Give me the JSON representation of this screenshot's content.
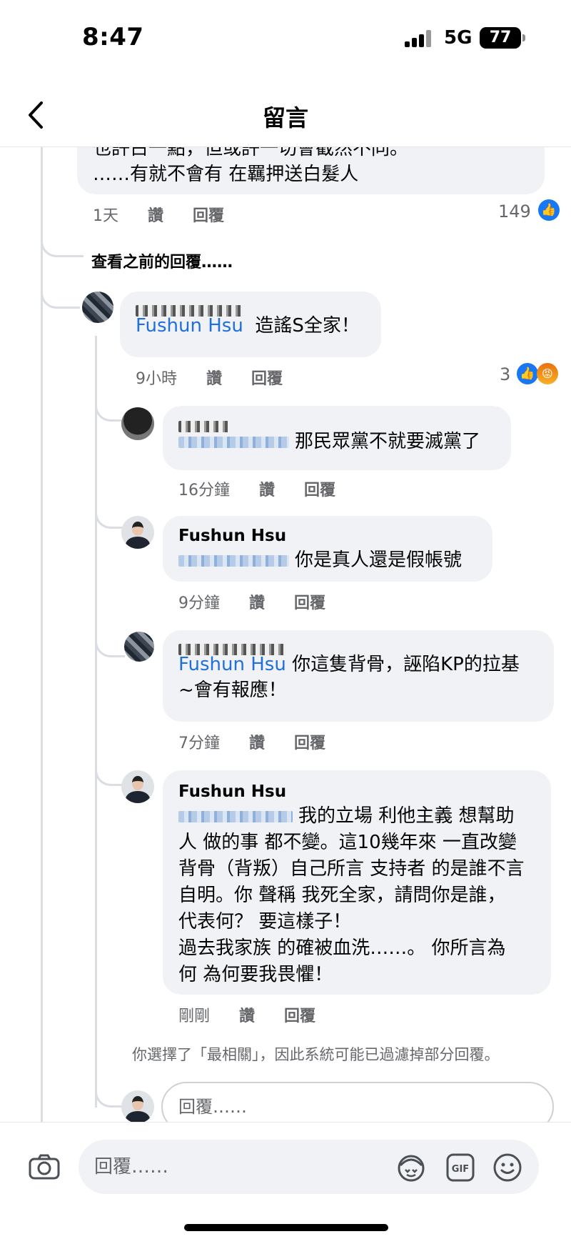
{
  "status": {
    "time": "8:47",
    "network": "5G",
    "battery": "77"
  },
  "header": {
    "title": "留言"
  },
  "top_comment": {
    "line1": "也許占一點，但或許一切會截然不同。",
    "line2": "……有就不會有 在羈押送白髮人",
    "time": "1天",
    "like": "讚",
    "reply": "回覆",
    "reactions": "149"
  },
  "view_previous": "查看之前的回覆……",
  "comments": [
    {
      "mention": "Fushun Hsu",
      "text": "造謠S全家！",
      "time": "9小時",
      "like": "讚",
      "reply": "回覆",
      "reactions": "3"
    },
    {
      "text": "那民眾黨不就要滅黨了",
      "time": "16分鐘",
      "like": "讚",
      "reply": "回覆"
    },
    {
      "name": "Fushun Hsu",
      "text": "你是真人還是假帳號",
      "time": "9分鐘",
      "like": "讚",
      "reply": "回覆"
    },
    {
      "mention": "Fushun Hsu",
      "text1": "你這隻背骨，誣陷KP的拉基",
      "text2": "~會有報應！",
      "time": "7分鐘",
      "like": "讚",
      "reply": "回覆"
    },
    {
      "name": "Fushun Hsu",
      "lines": [
        "我的立場 利他主義 想幫助",
        "人 做的事 都不變。這10幾年來 一直改變",
        "背骨（背叛）自己所言 支持者 的是誰不言",
        "自明。你 聲稱 我死全家，請問你是誰，",
        "代表何？ 要這樣子！",
        "過去我家族 的確被血洗……。 你所言為",
        "何 為何要我畏懼！"
      ],
      "time": "剛剛",
      "like": "讚",
      "reply": "回覆"
    }
  ],
  "filter_note": "你選擇了「最相關」，因此系統可能已過濾掉部分回覆。",
  "reply_placeholder": "回覆……",
  "composer_placeholder": "回覆……",
  "icons": {
    "back": "chevron-left-icon",
    "camera": "camera-icon",
    "avatar_sticker": "avatar-sticker-icon",
    "gif": "gif-icon",
    "emoji": "emoji-icon"
  },
  "colors": {
    "mention": "#216fdb",
    "like": "#1877f2",
    "bubble": "#f0f2f5"
  }
}
